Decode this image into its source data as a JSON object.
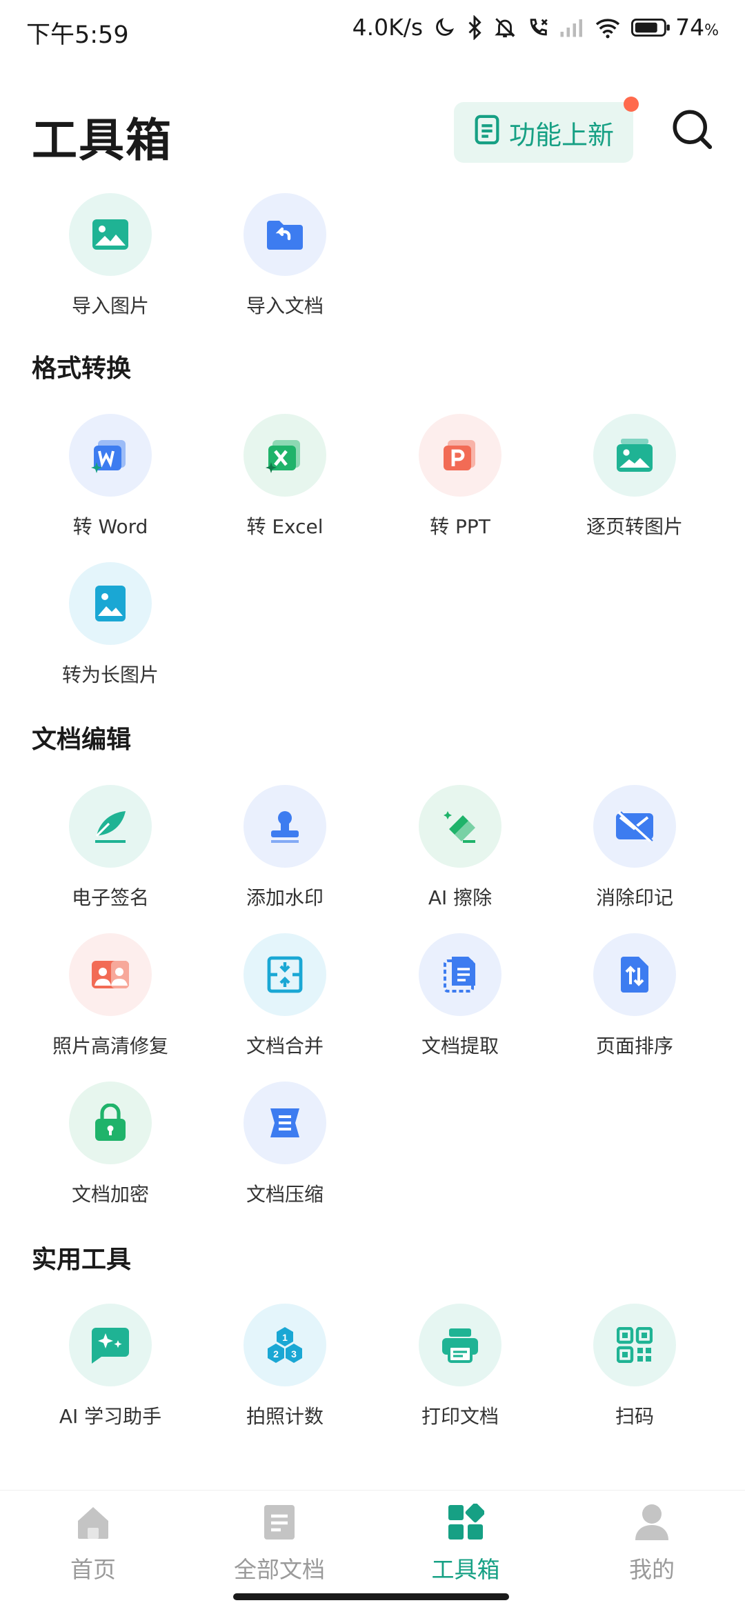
{
  "status": {
    "time": "下午5:59",
    "net_speed": "4.0K/s",
    "battery": "74",
    "battery_unit": "%"
  },
  "header": {
    "title": "工具箱",
    "new_features_label": "功能上新",
    "search_icon": "search-icon"
  },
  "quick": [
    {
      "label": "导入图片",
      "icon": "image-icon"
    },
    {
      "label": "导入文档",
      "icon": "folder-import-icon"
    }
  ],
  "sections": {
    "format": {
      "title": "格式转换",
      "items": [
        {
          "label": "转 Word"
        },
        {
          "label": "转 Excel"
        },
        {
          "label": "转 PPT"
        },
        {
          "label": "逐页转图片"
        },
        {
          "label": "转为长图片"
        }
      ]
    },
    "edit": {
      "title": "文档编辑",
      "items": [
        {
          "label": "电子签名"
        },
        {
          "label": "添加水印"
        },
        {
          "label": "AI 擦除"
        },
        {
          "label": "消除印记"
        },
        {
          "label": "照片高清修复"
        },
        {
          "label": "文档合并"
        },
        {
          "label": "文档提取"
        },
        {
          "label": "页面排序"
        },
        {
          "label": "文档加密"
        },
        {
          "label": "文档压缩"
        }
      ]
    },
    "util": {
      "title": "实用工具",
      "items": [
        {
          "label": "AI 学习助手"
        },
        {
          "label": "拍照计数"
        },
        {
          "label": "打印文档"
        },
        {
          "label": "扫码"
        }
      ]
    }
  },
  "nav": {
    "items": [
      {
        "label": "首页",
        "icon": "home-icon"
      },
      {
        "label": "全部文档",
        "icon": "document-icon"
      },
      {
        "label": "工具箱",
        "icon": "toolbox-icon",
        "active": true
      },
      {
        "label": "我的",
        "icon": "user-icon"
      }
    ]
  },
  "colors": {
    "accent": "#16a084",
    "badge": "#ff6a4d",
    "blue": "#3d7cf0",
    "red": "#f26b55",
    "cyan": "#1aa7d4"
  }
}
